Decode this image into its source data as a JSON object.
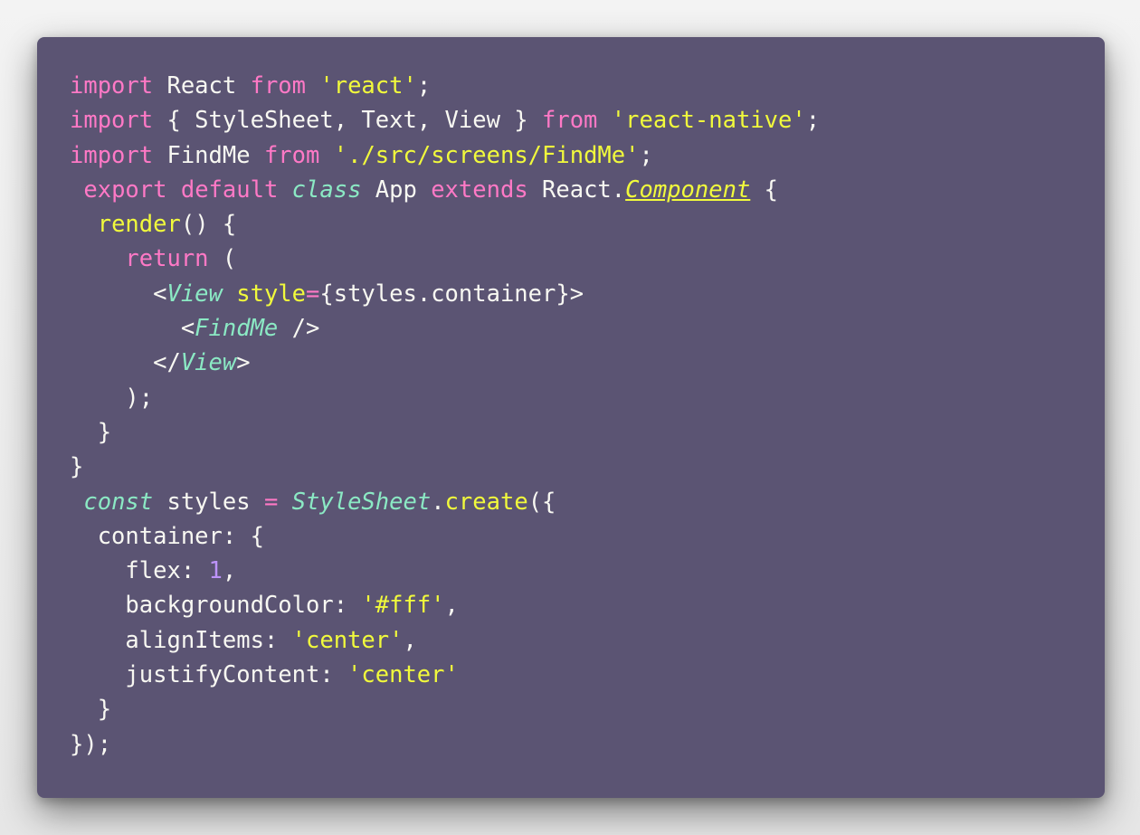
{
  "colors": {
    "background": "#5b5473",
    "keyword": "#ff79c6",
    "string": "#f1fa3c",
    "type": "#8be9c4",
    "number": "#bd93f9",
    "text": "#f8f8f2"
  },
  "lines": [
    [
      [
        "keyword",
        "import"
      ],
      [
        "plain",
        " React "
      ],
      [
        "keyword",
        "from"
      ],
      [
        "plain",
        " "
      ],
      [
        "string",
        "'react'"
      ],
      [
        "plain",
        ";"
      ]
    ],
    [
      [
        "keyword",
        "import"
      ],
      [
        "plain",
        " { StyleSheet, Text, View } "
      ],
      [
        "keyword",
        "from"
      ],
      [
        "plain",
        " "
      ],
      [
        "string",
        "'react-native'"
      ],
      [
        "plain",
        ";"
      ]
    ],
    [
      [
        "keyword",
        "import"
      ],
      [
        "plain",
        " FindMe "
      ],
      [
        "keyword",
        "from"
      ],
      [
        "plain",
        " "
      ],
      [
        "string",
        "'./src/screens/FindMe'"
      ],
      [
        "plain",
        ";"
      ]
    ],
    [
      [
        "plain",
        " "
      ],
      [
        "keyword",
        "export"
      ],
      [
        "plain",
        " "
      ],
      [
        "keyword",
        "default"
      ],
      [
        "plain",
        " "
      ],
      [
        "type",
        "class"
      ],
      [
        "plain",
        " App "
      ],
      [
        "keyword",
        "extends"
      ],
      [
        "plain",
        " React."
      ],
      [
        "type-u",
        "Component"
      ],
      [
        "plain",
        " {"
      ]
    ],
    [
      [
        "plain",
        "  "
      ],
      [
        "func",
        "render"
      ],
      [
        "plain",
        "() {"
      ]
    ],
    [
      [
        "plain",
        "    "
      ],
      [
        "keyword",
        "return"
      ],
      [
        "plain",
        " ("
      ]
    ],
    [
      [
        "plain",
        "      <"
      ],
      [
        "type",
        "View"
      ],
      [
        "plain",
        " "
      ],
      [
        "func",
        "style"
      ],
      [
        "keyword",
        "="
      ],
      [
        "plain",
        "{styles.container}>"
      ]
    ],
    [
      [
        "plain",
        "        <"
      ],
      [
        "type",
        "FindMe"
      ],
      [
        "plain",
        " />"
      ]
    ],
    [
      [
        "plain",
        "      </"
      ],
      [
        "type",
        "View"
      ],
      [
        "plain",
        ">"
      ]
    ],
    [
      [
        "plain",
        "    );"
      ]
    ],
    [
      [
        "plain",
        "  }"
      ]
    ],
    [
      [
        "plain",
        "}"
      ]
    ],
    [
      [
        "plain",
        " "
      ],
      [
        "type",
        "const"
      ],
      [
        "plain",
        " styles "
      ],
      [
        "keyword",
        "="
      ],
      [
        "plain",
        " "
      ],
      [
        "type",
        "StyleSheet"
      ],
      [
        "plain",
        "."
      ],
      [
        "func",
        "create"
      ],
      [
        "plain",
        "({"
      ]
    ],
    [
      [
        "plain",
        "  container: {"
      ]
    ],
    [
      [
        "plain",
        "    flex: "
      ],
      [
        "number",
        "1"
      ],
      [
        "plain",
        ","
      ]
    ],
    [
      [
        "plain",
        "    backgroundColor: "
      ],
      [
        "string",
        "'#fff'"
      ],
      [
        "plain",
        ","
      ]
    ],
    [
      [
        "plain",
        "    alignItems: "
      ],
      [
        "string",
        "'center'"
      ],
      [
        "plain",
        ","
      ]
    ],
    [
      [
        "plain",
        "    justifyContent: "
      ],
      [
        "string",
        "'center'"
      ]
    ],
    [
      [
        "plain",
        "  }"
      ]
    ],
    [
      [
        "plain",
        "});"
      ]
    ]
  ]
}
